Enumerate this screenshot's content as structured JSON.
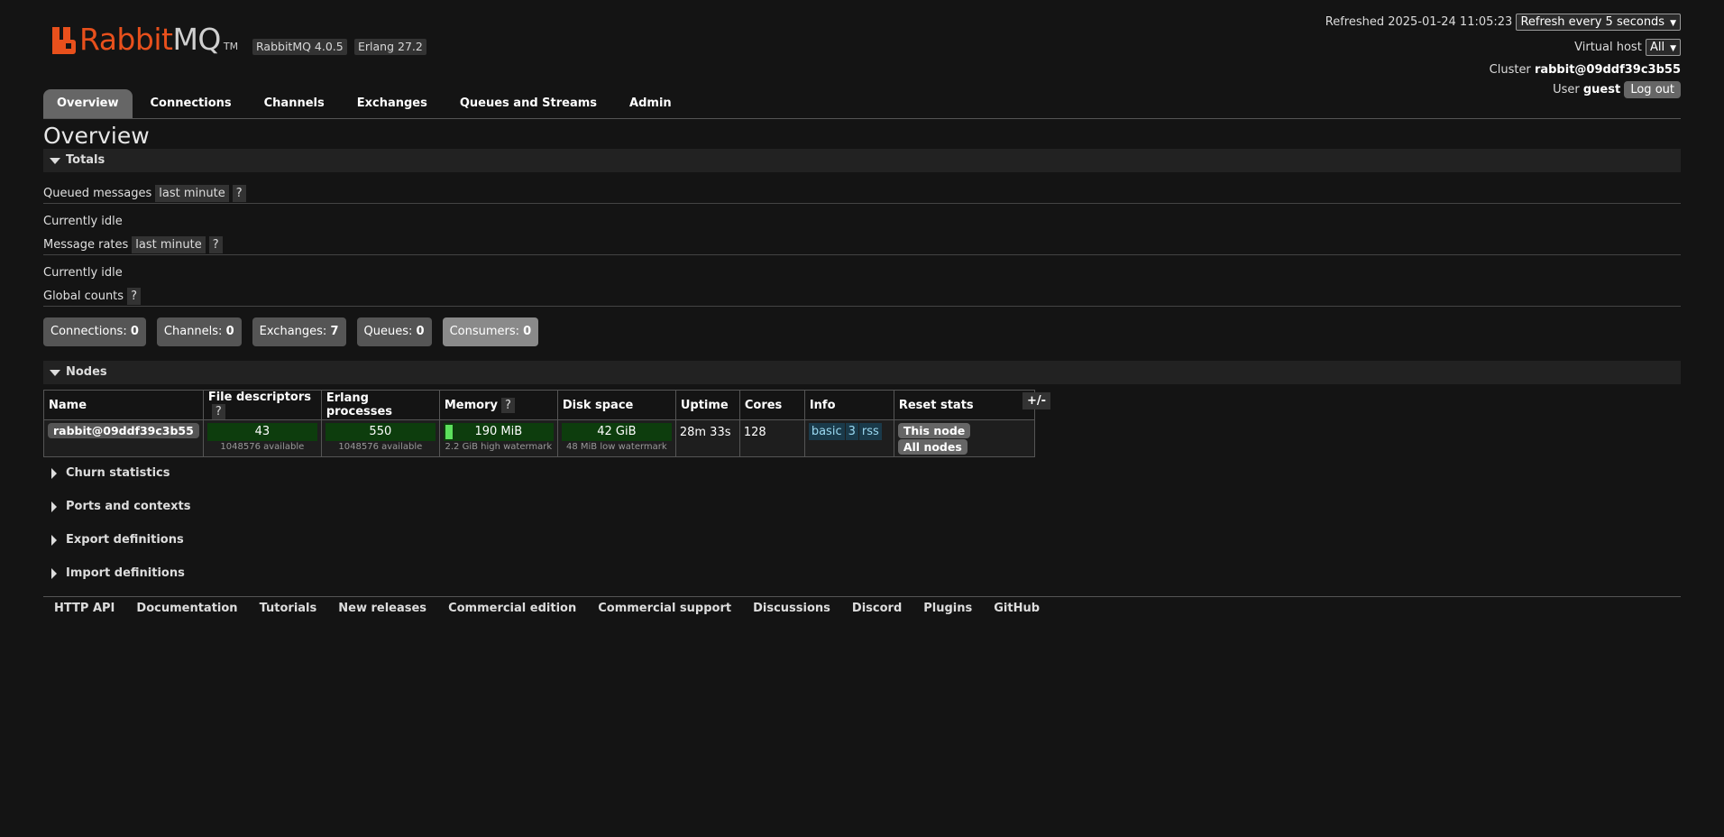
{
  "header": {
    "logo_text_1": "Rabbit",
    "logo_text_2": "MQ",
    "logo_tm": "TM",
    "version": "RabbitMQ 4.0.5",
    "erlang": "Erlang 27.2",
    "refreshed": "Refreshed 2025-01-24 11:05:23",
    "refresh_select": "Refresh every 5 seconds",
    "vhost_label": "Virtual host",
    "vhost_select": "All",
    "cluster_label": "Cluster",
    "cluster_name": "rabbit@09ddf39c3b55",
    "user_label": "User",
    "user_name": "guest",
    "logout": "Log out"
  },
  "tabs": [
    "Overview",
    "Connections",
    "Channels",
    "Exchanges",
    "Queues and Streams",
    "Admin"
  ],
  "page_title": "Overview",
  "totals": {
    "title": "Totals",
    "queued_label": "Queued messages",
    "queued_badge": "last minute",
    "help": "?",
    "idle_1": "Currently idle",
    "rates_label": "Message rates",
    "rates_badge": "last minute",
    "idle_2": "Currently idle",
    "global_label": "Global counts"
  },
  "counts": [
    {
      "label": "Connections:",
      "value": "0"
    },
    {
      "label": "Channels:",
      "value": "0"
    },
    {
      "label": "Exchanges:",
      "value": "7"
    },
    {
      "label": "Queues:",
      "value": "0"
    },
    {
      "label": "Consumers:",
      "value": "0"
    }
  ],
  "nodes": {
    "title": "Nodes",
    "headers": [
      "Name",
      "File descriptors",
      "Erlang processes",
      "Memory",
      "Disk space",
      "Uptime",
      "Cores",
      "Info",
      "Reset stats"
    ],
    "help": "?",
    "plusminus": "+/-",
    "row": {
      "name": "rabbit@09ddf39c3b55",
      "fd_value": "43",
      "fd_sub": "1048576 available",
      "proc_value": "550",
      "proc_sub": "1048576 available",
      "mem_value": "190 MiB",
      "mem_sub": "2.2 GiB high watermark",
      "disk_value": "42 GiB",
      "disk_sub": "48 MiB low watermark",
      "uptime": "28m 33s",
      "cores": "128",
      "info": [
        "basic",
        "3",
        "rss"
      ],
      "reset_this": "This node",
      "reset_all": "All nodes"
    }
  },
  "collapsed_sections": [
    "Churn statistics",
    "Ports and contexts",
    "Export definitions",
    "Import definitions"
  ],
  "footer": [
    "HTTP API",
    "Documentation",
    "Tutorials",
    "New releases",
    "Commercial edition",
    "Commercial support",
    "Discussions",
    "Discord",
    "Plugins",
    "GitHub"
  ]
}
